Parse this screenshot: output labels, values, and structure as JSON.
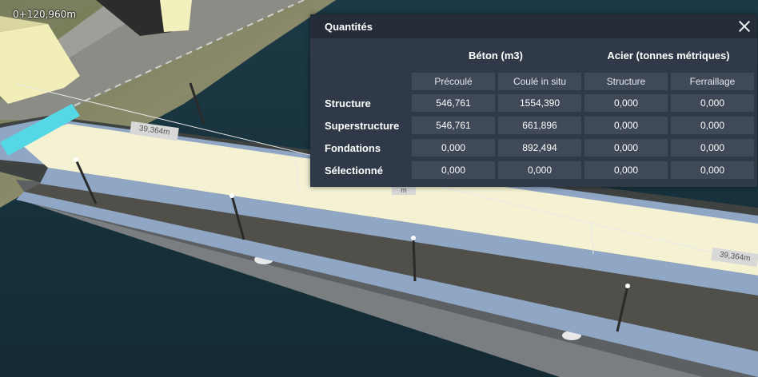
{
  "viewport": {
    "chainage_label": "0+120,960m",
    "dimension_labels": [
      "39,364m",
      "39,364m",
      "m"
    ]
  },
  "panel": {
    "title": "Quantités",
    "groups": [
      "Béton (m3)",
      "Acier (tonnes métriques)"
    ],
    "columns": [
      "Précoulé",
      "Coulé in situ",
      "Structure",
      "Ferraillage"
    ],
    "rows": [
      {
        "label": "Structure",
        "values": [
          "546,761",
          "1554,390",
          "0,000",
          "0,000"
        ]
      },
      {
        "label": "Superstructure",
        "values": [
          "546,761",
          "661,896",
          "0,000",
          "0,000"
        ]
      },
      {
        "label": "Fondations",
        "values": [
          "0,000",
          "892,494",
          "0,000",
          "0,000"
        ]
      },
      {
        "label": "Sélectionné",
        "values": [
          "0,000",
          "0,000",
          "0,000",
          "0,000"
        ]
      }
    ]
  },
  "colors": {
    "water": "#17303a",
    "deck": "#f4f2d3",
    "lane": "#8fa6c4",
    "asphalt": "#4b4d4b",
    "accent": "#55d8e6",
    "panel_bg": "#2f3947",
    "panel_header": "#242c37",
    "cell_bg": "#3f4958"
  }
}
